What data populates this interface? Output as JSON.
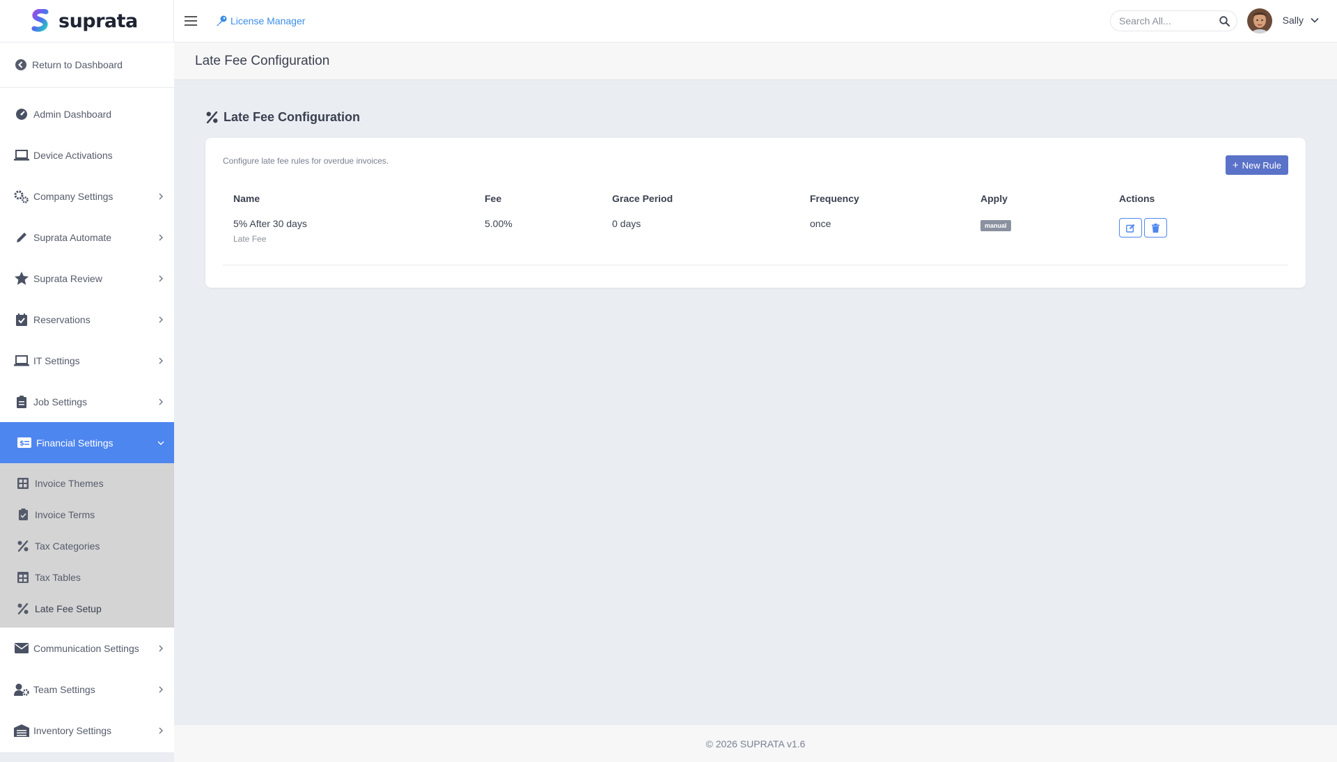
{
  "app": {
    "name": "suprata"
  },
  "sidebar": {
    "return_label": "Return to Dashboard",
    "items": [
      {
        "label": "Admin Dashboard",
        "icon": "gauge-icon"
      },
      {
        "label": "Device Activations",
        "icon": "laptop-icon"
      },
      {
        "label": "Company Settings",
        "icon": "cogs-icon"
      },
      {
        "label": "Suprata Automate",
        "icon": "pen-icon"
      },
      {
        "label": "Suprata Review",
        "icon": "star-icon"
      },
      {
        "label": "Reservations",
        "icon": "calendar-check-icon"
      },
      {
        "label": "IT Settings",
        "icon": "laptop-icon"
      },
      {
        "label": "Job Settings",
        "icon": "clipboard-icon"
      },
      {
        "label": "Financial Settings",
        "icon": "money-card-icon"
      }
    ],
    "financial_sub": [
      {
        "label": "Invoice Themes",
        "icon": "grid-icon"
      },
      {
        "label": "Invoice Terms",
        "icon": "clipboard-check-icon"
      },
      {
        "label": "Tax Categories",
        "icon": "percent-icon"
      },
      {
        "label": "Tax Tables",
        "icon": "table-icon"
      },
      {
        "label": "Late Fee Setup",
        "icon": "percent-icon"
      }
    ],
    "items_after": [
      {
        "label": "Communication Settings",
        "icon": "envelope-icon"
      },
      {
        "label": "Team Settings",
        "icon": "user-cog-icon"
      },
      {
        "label": "Inventory Settings",
        "icon": "warehouse-icon"
      }
    ]
  },
  "topbar": {
    "license_label": "License Manager",
    "search_placeholder": "Search All...",
    "user_name": "Sally"
  },
  "page": {
    "header_title": "Late Fee Configuration",
    "section_title": "Late Fee Configuration",
    "description": "Configure late fee rules for overdue invoices.",
    "new_rule_label": "New Rule"
  },
  "table": {
    "columns": [
      "Name",
      "Fee",
      "Grace Period",
      "Frequency",
      "Apply",
      "Actions"
    ],
    "rows": [
      {
        "name": "5% After 30 days",
        "type": "Late Fee",
        "fee": "5.00%",
        "grace": "0 days",
        "frequency": "once",
        "apply": "manual"
      }
    ]
  },
  "footer": {
    "text": "© 2026 SUPRATA v1.6"
  },
  "colors": {
    "accent": "#4e86f0",
    "button": "#5a72c8",
    "link": "#3a8de8"
  }
}
